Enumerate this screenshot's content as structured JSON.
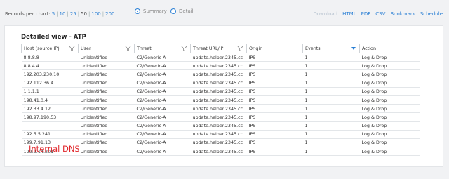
{
  "toolbar": {
    "records_label": "Records per chart:",
    "records_options": [
      "5",
      "10",
      "25",
      "50",
      "100",
      "200"
    ],
    "records_selected": "50",
    "view_summary": "Summary",
    "view_detail": "Detail",
    "selected_view": "Summary",
    "download": "Download",
    "html": "HTML",
    "pdf": "PDF",
    "csv": "CSV",
    "bookmark": "Bookmark",
    "schedule": "Schedule"
  },
  "panel": {
    "title": "Detailed view - ATP",
    "columns": [
      "Host (source IP)",
      "User",
      "Threat",
      "Threat URL/IP",
      "Origin",
      "Events",
      "Action"
    ],
    "rows": [
      [
        "8.8.8.8",
        "Unidentified",
        "C2/Generic-A",
        "update.helper.2345.cc",
        "IPS",
        "1",
        "Log & Drop"
      ],
      [
        "8.8.4.4",
        "Unidentified",
        "C2/Generic-A",
        "update.helper.2345.cc",
        "IPS",
        "1",
        "Log & Drop"
      ],
      [
        "192.203.230.10",
        "Unidentified",
        "C2/Generic-A",
        "update.helper.2345.cc",
        "IPS",
        "1",
        "Log & Drop"
      ],
      [
        "192.112.36.4",
        "Unidentified",
        "C2/Generic-A",
        "update.helper.2345.cc",
        "IPS",
        "1",
        "Log & Drop"
      ],
      [
        "1.1.1.1",
        "Unidentified",
        "C2/Generic-A",
        "update.helper.2345.cc",
        "IPS",
        "1",
        "Log & Drop"
      ],
      [
        "198.41.0.4",
        "Unidentified",
        "C2/Generic-A",
        "update.helper.2345.cc",
        "IPS",
        "1",
        "Log & Drop"
      ],
      [
        "192.33.4.12",
        "Unidentified",
        "C2/Generic-A",
        "update.helper.2345.cc",
        "IPS",
        "1",
        "Log & Drop"
      ],
      [
        "198.97.190.53",
        "Unidentified",
        "C2/Generic-A",
        "update.helper.2345.cc",
        "IPS",
        "1",
        "Log & Drop"
      ],
      [
        "",
        "Unidentified",
        "C2/Generic-A",
        "update.helper.2345.cc",
        "IPS",
        "1",
        "Log & Drop"
      ],
      [
        "192.5.5.241",
        "Unidentified",
        "C2/Generic-A",
        "update.helper.2345.cc",
        "IPS",
        "1",
        "Log & Drop"
      ],
      [
        "199.7.91.13",
        "Unidentified",
        "C2/Generic-A",
        "update.helper.2345.cc",
        "IPS",
        "1",
        "Log & Drop"
      ],
      [
        "199.9.14.201",
        "Unidentified",
        "C2/Generic-A",
        "update.helper.2345.cc",
        "IPS",
        "1",
        "Log & Drop"
      ]
    ],
    "annotation": "Internal DNS",
    "annotation_color": "#e0272c"
  },
  "icons": {
    "filter": "filter-icon",
    "sort": "sort-desc-icon"
  },
  "colors": {
    "link": "#2a7fd4",
    "disabled_link": "#b8c4d0",
    "background": "#f1f2f4"
  }
}
